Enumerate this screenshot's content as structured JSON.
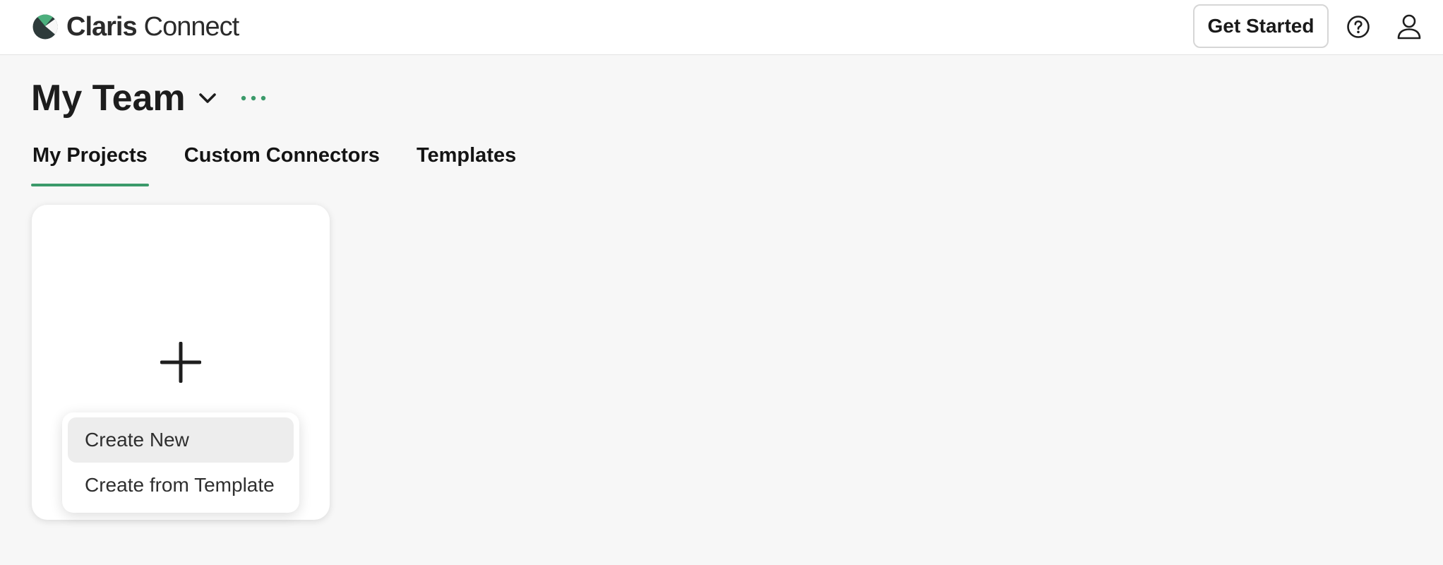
{
  "header": {
    "logo": {
      "brand": "Claris",
      "product": "Connect",
      "icon": "claris-logo-mark"
    },
    "get_started_label": "Get Started",
    "help_icon": "help-circle-icon",
    "profile_icon": "user-profile-icon"
  },
  "team": {
    "name": "My Team",
    "chevron_icon": "chevron-down-icon",
    "more_icon": "more-horizontal-icon"
  },
  "tabs": [
    {
      "label": "My Projects",
      "active": true
    },
    {
      "label": "Custom Connectors",
      "active": false
    },
    {
      "label": "Templates",
      "active": false
    }
  ],
  "new_project_card": {
    "icon": "plus-icon"
  },
  "create_menu": {
    "items": [
      {
        "label": "Create New",
        "highlighted": true
      },
      {
        "label": "Create from Template",
        "highlighted": false
      }
    ]
  },
  "colors": {
    "accent_green": "#3b9a6a",
    "background": "#f7f7f7",
    "logo_green": "#4caf7d",
    "logo_dark": "#2d3a3a"
  }
}
